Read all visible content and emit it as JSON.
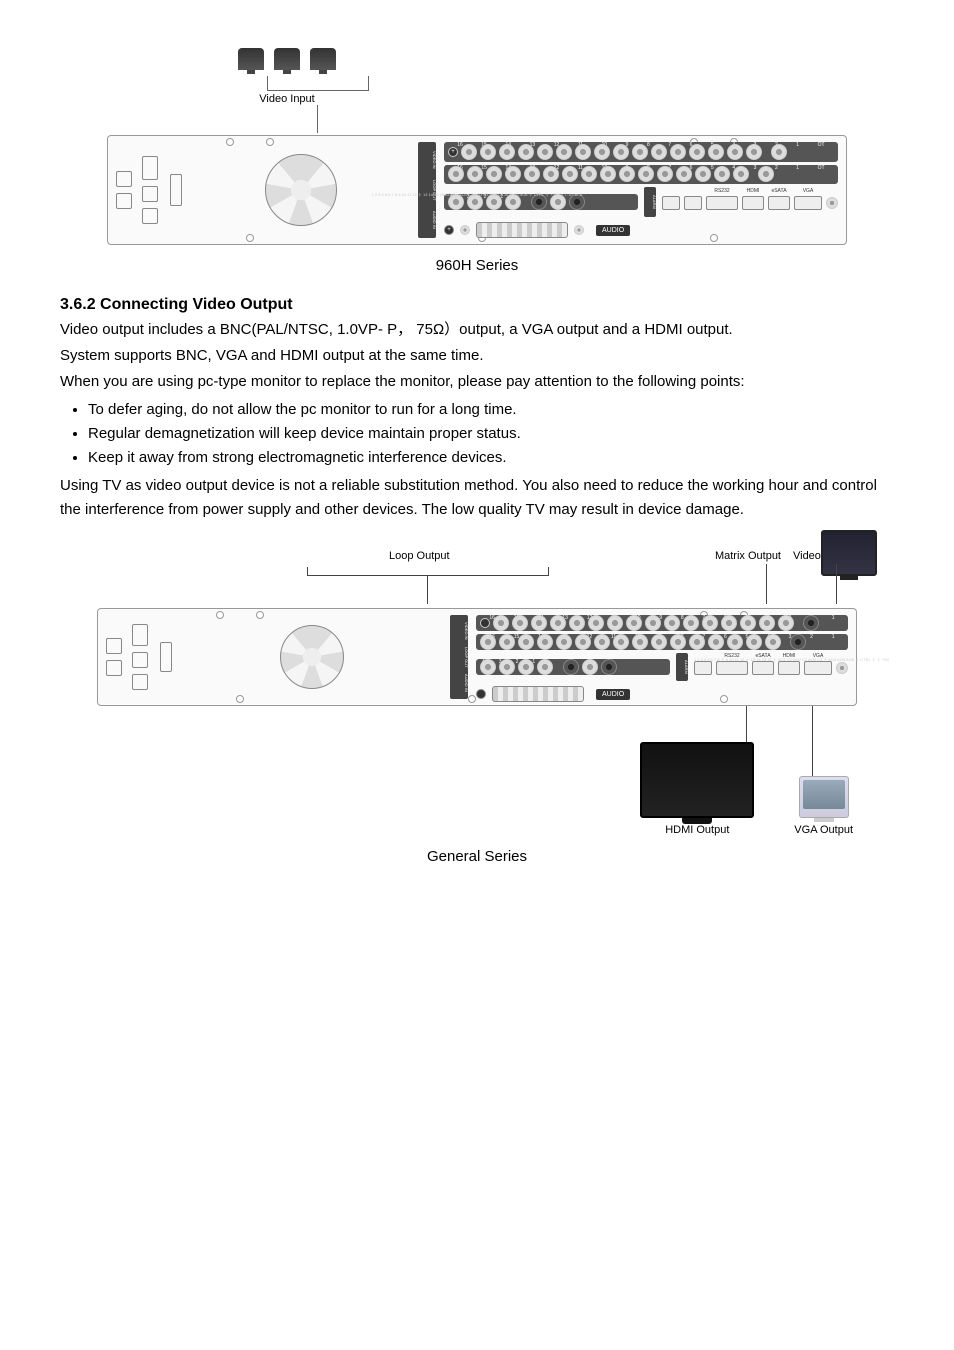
{
  "figure1": {
    "video_input_label": "Video Input",
    "caption": "960H Series",
    "row_labels": [
      "VIDEO IN",
      "LOOP OUT",
      "AUDIO IN"
    ],
    "row1_numbers": [
      "16",
      "15",
      "14",
      "13",
      "12",
      "11",
      "10",
      "9",
      "8",
      "7",
      "6",
      "5",
      "4",
      "3",
      "2",
      "1",
      "OT"
    ],
    "row2_numbers": [
      "16",
      "15",
      "14",
      "13",
      "12",
      "11",
      "10",
      "9",
      "8",
      "7",
      "6",
      "5",
      "4",
      "3",
      "2",
      "1",
      "OT"
    ],
    "row3_numbers": [
      "4",
      "3",
      "2",
      "1"
    ],
    "audio_label": "AUDIO",
    "alarm_label": "ALARM",
    "terminal_labels": "1 2 3 4 5 6 7 8 9 10 11 12 ⏚ 13 14 15 16 AO1C1 AO1 C2 AO3 C3 AO4 C4 AO5 C5 AO6 ⏚  CTRL ⏚ +5V T+ T- A+ A- B",
    "ports": {
      "rs232": "RS232",
      "hdmi": "HDMI",
      "esata": "eSATA",
      "vga": "VGA"
    }
  },
  "section": {
    "heading": "3.6.2   Connecting Video Output",
    "p1": "Video output includes a BNC(PAL/NTSC, 1.0VP- P，  75Ω）output, a VGA output and a HDMI output.",
    "p2": "System supports BNC, VGA and HDMI output at the same time.",
    "p3": "When you are using pc-type monitor to replace the monitor, please pay attention to the following points:",
    "b1": "To defer aging, do not allow the pc monitor to run for a long time.",
    "b2": "Regular demagnetization will keep device maintain proper status.",
    "b3": "Keep it away from strong electromagnetic interference devices.",
    "p4": "Using TV as video output device is not a reliable substitution method. You also need to reduce the working hour and control the interference from power supply and other devices. The low quality TV may result in device damage."
  },
  "figure2": {
    "loop_output_label": "Loop Output",
    "matrix_output_label": "Matrix Output",
    "video_output_label": "Video Output",
    "row_labels": [
      "VIDEO IN",
      "LOOP OUT",
      "AUDIO IN"
    ],
    "row1_numbers": [
      "16",
      "15",
      "14",
      "13",
      "12",
      "11",
      "10",
      "9",
      "8",
      "7",
      "6",
      "5",
      "4",
      "3",
      "2",
      "1"
    ],
    "row2_numbers": [
      "16",
      "15",
      "14",
      "13",
      "12",
      "11",
      "10",
      "9",
      "8",
      "7",
      "6",
      "5",
      "4",
      "3",
      "2",
      "1"
    ],
    "row3_numbers": [
      "4",
      "3",
      "2",
      "1"
    ],
    "audio_label": "AUDIO",
    "alarm_label": "ALARM",
    "terminal_labels": "1 2 3 4 5 6 7 8 ⏚ 9 10 11 12 ⏚ 13 14 15 16 ⏚ AO1 C1 AO2 C2 AO3 C3 ⏚ AO4 AO5 AO6 ⏚ CTRL ⏚ ⏚ +5V",
    "ports": {
      "rs232": "RS232",
      "hdmi": "HDMI",
      "esata": "eSATA",
      "vga": "VGA"
    },
    "hdmi_output_label": "HDMI Output",
    "vga_output_label": "VGA Output",
    "caption": "General Series"
  }
}
